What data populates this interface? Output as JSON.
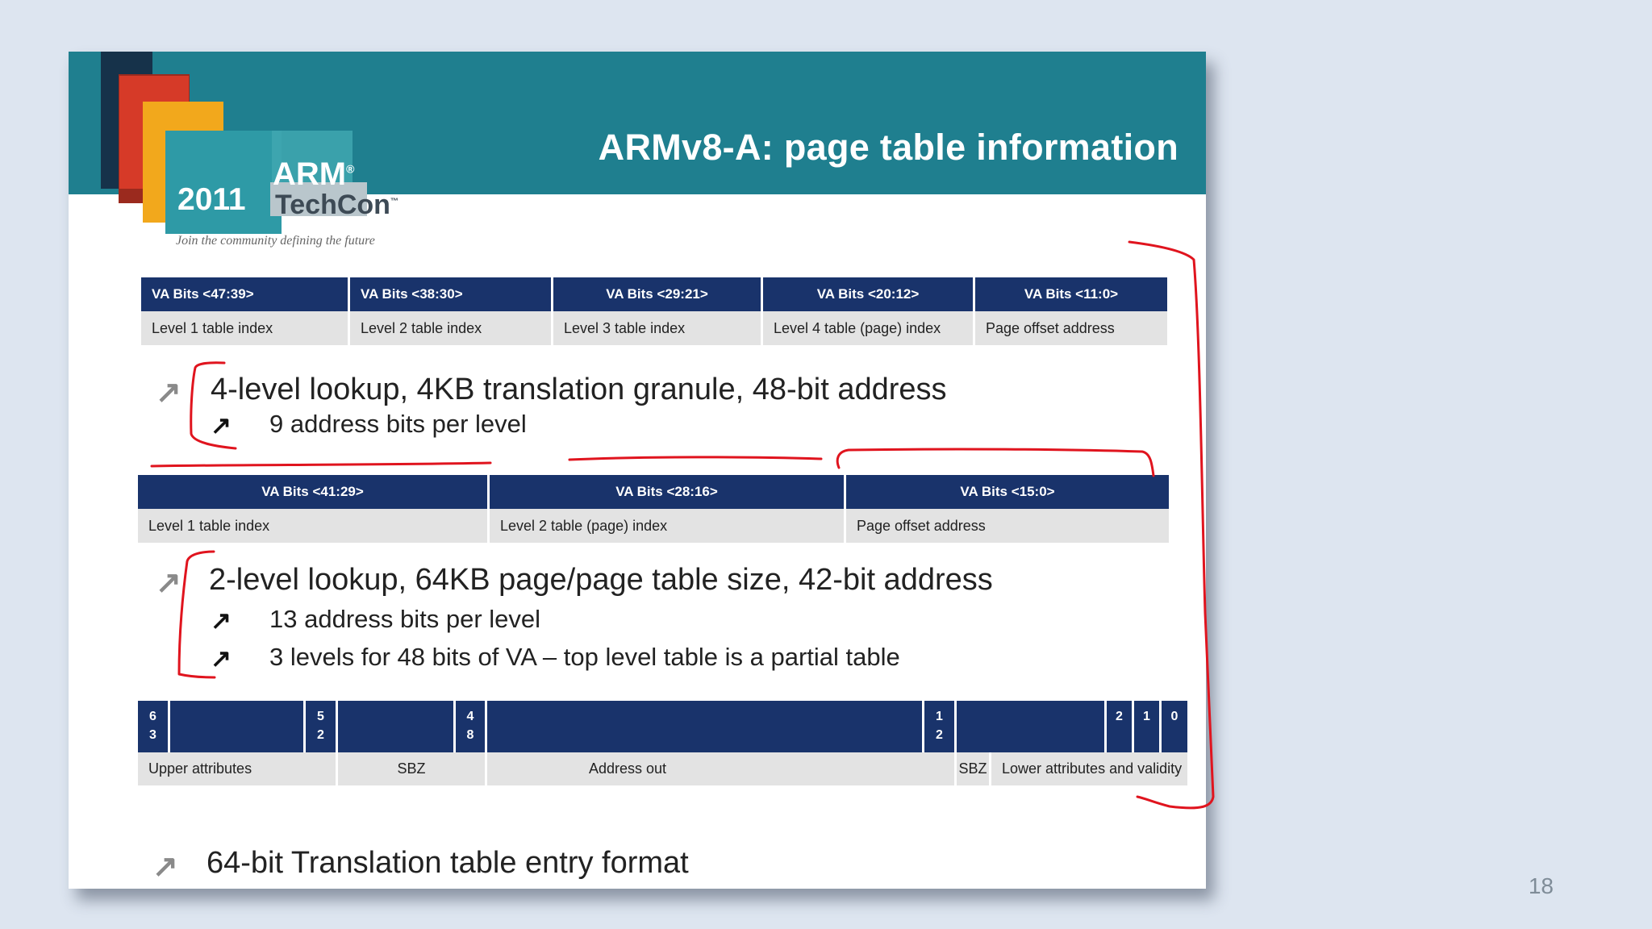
{
  "slide": {
    "title": "ARMv8-A: page table information",
    "logo": {
      "brand": "ARM",
      "year": "2011",
      "event": "TechCon",
      "tagline": "Join the community defining the future",
      "trademark": "®",
      "tm": "™"
    },
    "table_4level": {
      "headers": [
        "VA Bits <47:39>",
        "VA Bits <38:30>",
        "VA Bits <29:21>",
        "VA Bits <20:12>",
        "VA Bits <11:0>"
      ],
      "cells": [
        "Level 1 table index",
        "Level 2 table index",
        "Level 3 table index",
        "Level 4 table (page) index",
        "Page offset address"
      ]
    },
    "bullet_4level": {
      "main": "4-level lookup, 4KB translation granule, 48-bit address",
      "subs": [
        "9 address bits per level"
      ]
    },
    "table_2level": {
      "headers": [
        "VA Bits <41:29>",
        "VA Bits <28:16>",
        "VA Bits <15:0>"
      ],
      "cells": [
        "Level 1 table index",
        "Level 2 table (page) index",
        "Page offset address"
      ]
    },
    "bullet_2level": {
      "main": "2-level lookup, 64KB page/page table size, 42-bit address",
      "subs": [
        "13 address bits per level",
        "3 levels for 48 bits of VA – top level table is a partial table"
      ]
    },
    "entry_table": {
      "bits": [
        "6\n3",
        "",
        "5\n2",
        "",
        "4\n8",
        "",
        "1\n2",
        "",
        "2",
        "1",
        "0"
      ],
      "fields": [
        "Upper attributes",
        "SBZ",
        "Address out",
        "SBZ",
        "Lower attributes and validity"
      ]
    },
    "bullet_entry": {
      "main": "64-bit Translation table entry  format"
    },
    "arrow_glyph": "↗"
  },
  "page_number": "18",
  "colors": {
    "background": "#dde5f0",
    "header_band": "#1f7f8f",
    "table_header": "#19336b",
    "table_cell": "#e3e3e3",
    "ink": "#e0141e"
  }
}
